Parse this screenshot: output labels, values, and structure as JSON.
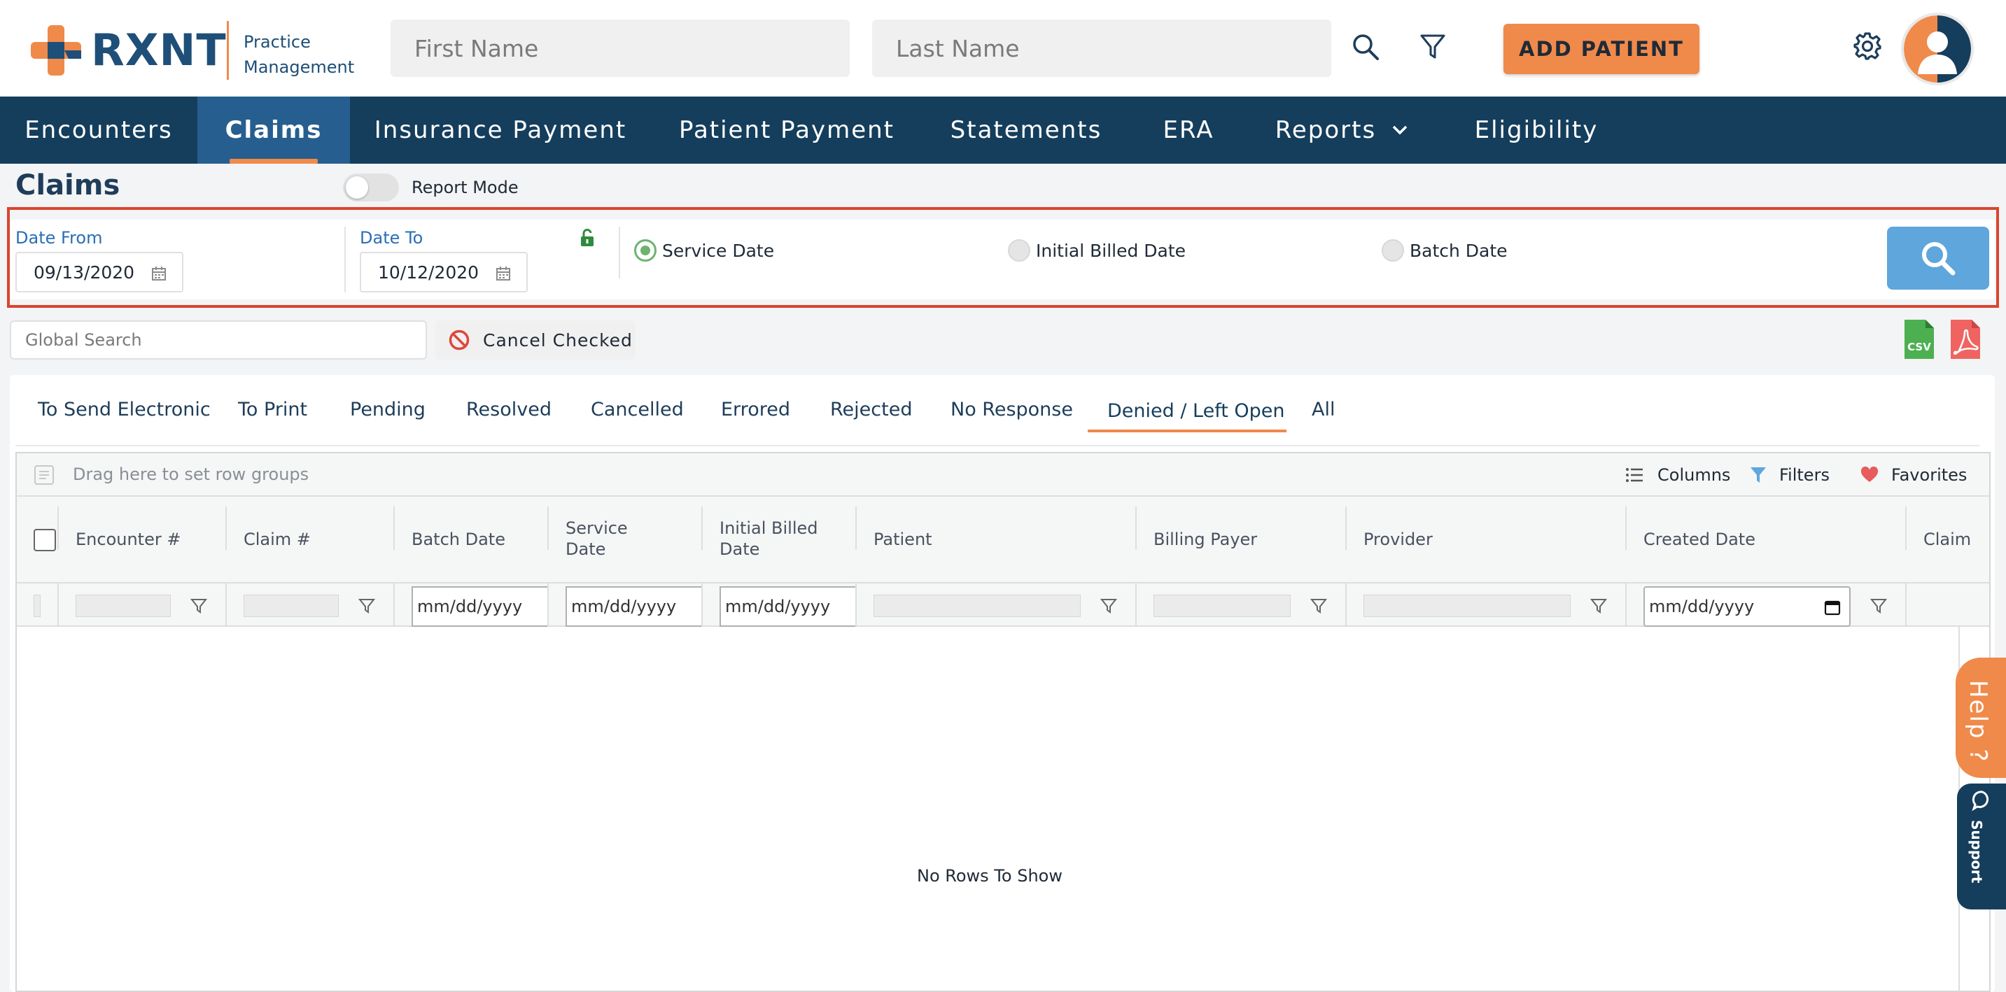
{
  "header": {
    "logo_text": "RXNT",
    "logo_sub_line1": "Practice",
    "logo_sub_line2": "Management",
    "first_name_placeholder": "First Name",
    "last_name_placeholder": "Last Name",
    "add_patient_label": "ADD PATIENT",
    "brand_orange": "#f08a4b",
    "brand_navy": "#153e5c"
  },
  "nav": {
    "items": [
      "Encounters",
      "Claims",
      "Insurance Payment",
      "Patient Payment",
      "Statements",
      "ERA",
      "Reports",
      "Eligibility"
    ],
    "active": "Claims"
  },
  "page": {
    "title": "Claims",
    "report_mode_label": "Report Mode"
  },
  "filters": {
    "date_from_label": "Date From",
    "date_from_value": "09/13/2020",
    "date_to_label": "Date To",
    "date_to_value": "10/12/2020",
    "radios": [
      "Service Date",
      "Initial Billed Date",
      "Batch Date"
    ],
    "selected_radio": "Service Date"
  },
  "toolbar": {
    "global_search_placeholder": "Global Search",
    "cancel_checked_label": "Cancel Checked",
    "csv_label": "CSV"
  },
  "tabs": {
    "items": [
      "To Send Electronic",
      "To Print",
      "Pending",
      "Resolved",
      "Cancelled",
      "Errored",
      "Rejected",
      "No Response",
      "Denied / Left Open",
      "All"
    ],
    "active": "Denied / Left Open"
  },
  "grid": {
    "group_bar_hint": "Drag here to set row groups",
    "columns_label": "Columns",
    "filters_label": "Filters",
    "favorites_label": "Favorites",
    "headers": [
      "Encounter #",
      "Claim #",
      "Batch Date",
      "Service Date",
      "Initial Billed Date",
      "Patient",
      "Billing Payer",
      "Provider",
      "Created Date",
      "Claim"
    ],
    "date_placeholder": "mm/dd/yyyy",
    "empty_message": "No Rows To Show"
  },
  "widgets": {
    "help_label": "Help ?",
    "support_label": "Support"
  }
}
